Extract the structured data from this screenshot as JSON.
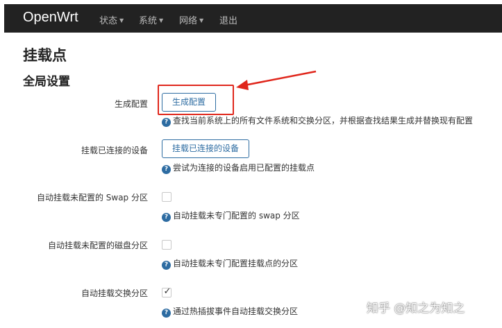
{
  "navbar": {
    "brand": "OpenWrt",
    "menus": [
      {
        "label": "状态"
      },
      {
        "label": "系统"
      },
      {
        "label": "网络"
      },
      {
        "label": "退出"
      }
    ]
  },
  "page_title": "挂载点",
  "section_title": "全局设置",
  "settings": [
    {
      "label": "生成配置",
      "button": "生成配置",
      "help": "查找当前系统上的所有文件系统和交换分区，并根据查找结果生成并替换现有配置"
    },
    {
      "label": "挂载已连接的设备",
      "button": "挂载已连接的设备",
      "help": "尝试为连接的设备启用已配置的挂载点"
    },
    {
      "label": "自动挂载未配置的 Swap 分区",
      "checked": false,
      "help": "自动挂载未专门配置的 swap 分区"
    },
    {
      "label": "自动挂载未配置的磁盘分区",
      "checked": false,
      "help": "自动挂载未专门配置挂载点的分区"
    },
    {
      "label": "自动挂载交换分区",
      "checked": true,
      "help": "通过热插拔事件自动挂载交换分区"
    }
  ],
  "help_icon_glyph": "?",
  "check_glyph": "✓",
  "annotation_color": "#e0261b",
  "accent_color": "#2d6ca2",
  "watermark": "知乎 @知之为知之"
}
